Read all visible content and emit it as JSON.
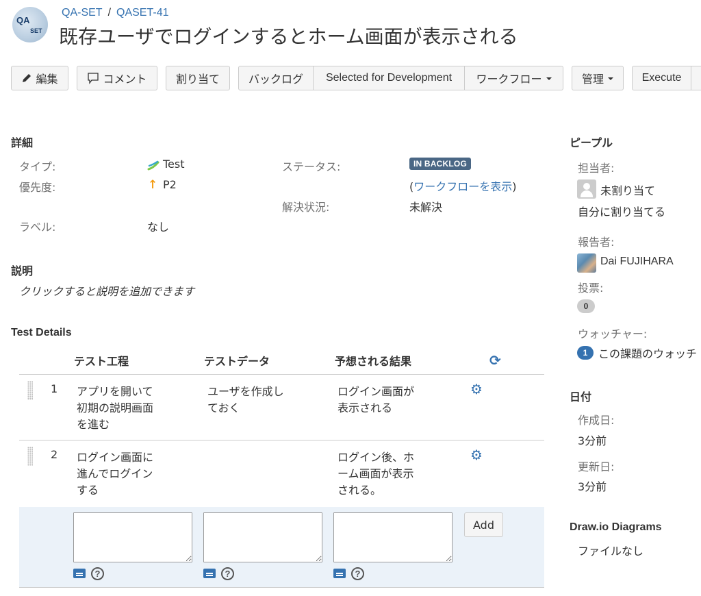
{
  "project": {
    "avatar_text_1": "QA",
    "avatar_text_2": "SET"
  },
  "breadcrumb": {
    "project": "QA-SET",
    "separator": "/",
    "issue_key": "QASET-41"
  },
  "title": "既存ユーザでログインするとホーム画面が表示される",
  "toolbar": {
    "edit": "編集",
    "comment": "コメント",
    "assign": "割り当て",
    "backlog": "バックログ",
    "selected": "Selected for Development",
    "workflow": "ワークフロー",
    "admin": "管理",
    "execute": "Execute"
  },
  "details": {
    "heading": "詳細",
    "type_label": "タイプ:",
    "type_value": "Test",
    "priority_label": "優先度:",
    "priority_value": "P2",
    "labels_label": "ラベル:",
    "labels_value": "なし",
    "status_label": "ステータス:",
    "status_value": "IN BACKLOG",
    "view_workflow_open": "(",
    "view_workflow": "ワークフローを表示",
    "view_workflow_close": ")",
    "resolution_label": "解決状況:",
    "resolution_value": "未解決"
  },
  "description": {
    "heading": "説明",
    "placeholder": "クリックすると説明を追加できます"
  },
  "test_details": {
    "heading": "Test Details",
    "columns": [
      "テスト工程",
      "テストデータ",
      "予想される結果"
    ],
    "rows": [
      {
        "num": "1",
        "step": [
          "アプリを開いて",
          "初期の説明画面",
          "を進む"
        ],
        "data": [
          "ユーザを作成し",
          "ておく"
        ],
        "result": [
          "ログイン画面が",
          "表示される"
        ]
      },
      {
        "num": "2",
        "step": [
          "ログイン画面に",
          "進んでログイン",
          "する"
        ],
        "data": [],
        "result": [
          "ログイン後、ホ",
          "ーム画面が表示",
          "される。"
        ]
      }
    ],
    "add_button": "Add",
    "help_glyph": "?"
  },
  "people": {
    "heading": "ピープル",
    "assignee_label": "担当者:",
    "assignee_value": "未割り当て",
    "assign_to_me": "自分に割り当てる",
    "reporter_label": "報告者:",
    "reporter_value": "Dai FUJIHARA",
    "votes_label": "投票:",
    "votes_count": "0",
    "watchers_label": "ウォッチャー:",
    "watchers_count": "1",
    "watch_text": "この課題のウォッチ"
  },
  "dates": {
    "heading": "日付",
    "created_label": "作成日:",
    "created_value": "3分前",
    "updated_label": "更新日:",
    "updated_value": "3分前"
  },
  "drawio": {
    "heading": "Draw.io Diagrams",
    "value": "ファイルなし"
  },
  "colors": {
    "link": "#3572b0",
    "status_lozenge": "#4a6785",
    "priority_arrow": "#f39c12"
  },
  "icons": [
    "pencil-icon",
    "comment-icon",
    "gear-icon",
    "refresh-icon",
    "help-icon",
    "folder-icon",
    "priority-arrow-icon",
    "test-type-icon"
  ]
}
